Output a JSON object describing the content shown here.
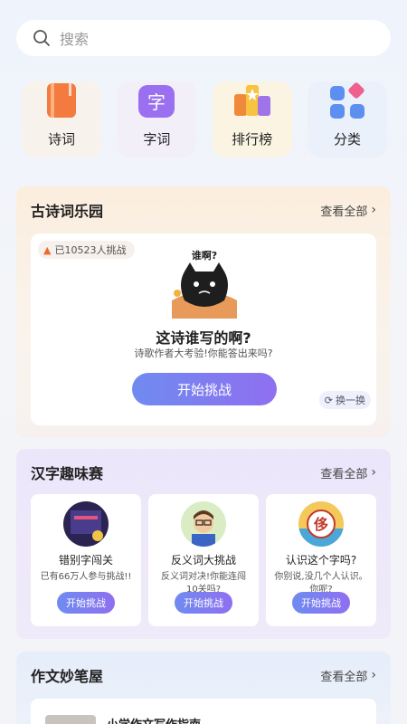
{
  "search": {
    "placeholder": "搜索"
  },
  "categories": [
    {
      "label": "诗词",
      "icon": "book-icon"
    },
    {
      "label": "字词",
      "icon": "character-icon",
      "glyph": "字"
    },
    {
      "label": "排行榜",
      "icon": "ranking-icon"
    },
    {
      "label": "分类",
      "icon": "category-grid-icon"
    }
  ],
  "poem_section": {
    "title": "古诗词乐园",
    "see_all": "查看全部",
    "badge": "已10523人挑战",
    "bubble": "谁啊?",
    "question": "这诗谁写的啊?",
    "subtitle": "诗歌作者大考验!你能答出来吗?",
    "start": "开始挑战",
    "refresh": "换一换"
  },
  "hanzi_section": {
    "title": "汉字趣味赛",
    "see_all": "查看全部",
    "games": [
      {
        "title": "错别字闯关",
        "desc": "已有66万人参与挑战!!",
        "button": "开始挑战",
        "icon": "game-thumb-icon"
      },
      {
        "title": "反义词大挑战",
        "desc": "反义词对决!你能连闯10关吗?",
        "button": "开始挑战",
        "icon": "boy-avatar-icon"
      },
      {
        "title": "认识这个字吗?",
        "desc": "你别说,没几个人认识。你呢?",
        "button": "开始挑战",
        "icon": "character-puzzle-icon",
        "glyph": "侈"
      }
    ]
  },
  "essay_section": {
    "title": "作文妙笔屋",
    "see_all": "查看全部",
    "first_item": "小学作文写作指南"
  }
}
